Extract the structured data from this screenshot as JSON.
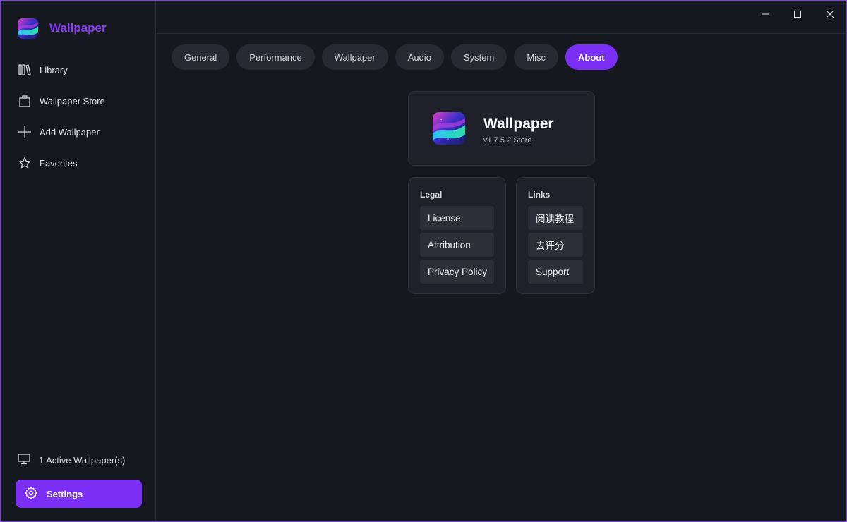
{
  "app": {
    "name": "Wallpaper",
    "accent": "#7c2ff4"
  },
  "sidebar": {
    "items": [
      {
        "label": "Library",
        "icon": "library-icon"
      },
      {
        "label": "Wallpaper Store",
        "icon": "shopping-bag-icon"
      },
      {
        "label": "Add Wallpaper",
        "icon": "plus-icon"
      },
      {
        "label": "Favorites",
        "icon": "star-icon"
      }
    ],
    "active_status": "1 Active Wallpaper(s)",
    "settings_label": "Settings"
  },
  "tabs": [
    {
      "label": "General"
    },
    {
      "label": "Performance"
    },
    {
      "label": "Wallpaper"
    },
    {
      "label": "Audio"
    },
    {
      "label": "System"
    },
    {
      "label": "Misc"
    },
    {
      "label": "About",
      "active": true
    }
  ],
  "about": {
    "name": "Wallpaper",
    "version": "v1.7.5.2 Store",
    "legal": {
      "title": "Legal",
      "items": [
        "License",
        "Attribution",
        "Privacy Policy"
      ]
    },
    "links": {
      "title": "Links",
      "items": [
        "阅读教程",
        "去评分",
        "Support"
      ]
    }
  }
}
